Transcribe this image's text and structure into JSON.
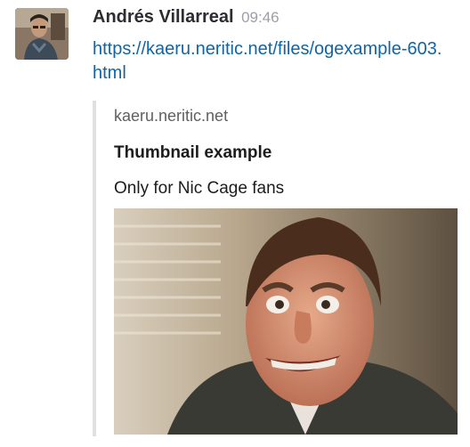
{
  "message": {
    "sender": "Andrés Villarreal",
    "time": "09:46",
    "link_text": "https://kaeru.neritic.net/files/ogexample-603.html"
  },
  "attachment": {
    "site": "kaeru.neritic.net",
    "title": "Thumbnail example",
    "description": "Only for Nic Cage fans"
  },
  "colors": {
    "link": "#1264a3",
    "timestamp": "#9e9ea6",
    "attachment_border": "#e0e0e0"
  }
}
